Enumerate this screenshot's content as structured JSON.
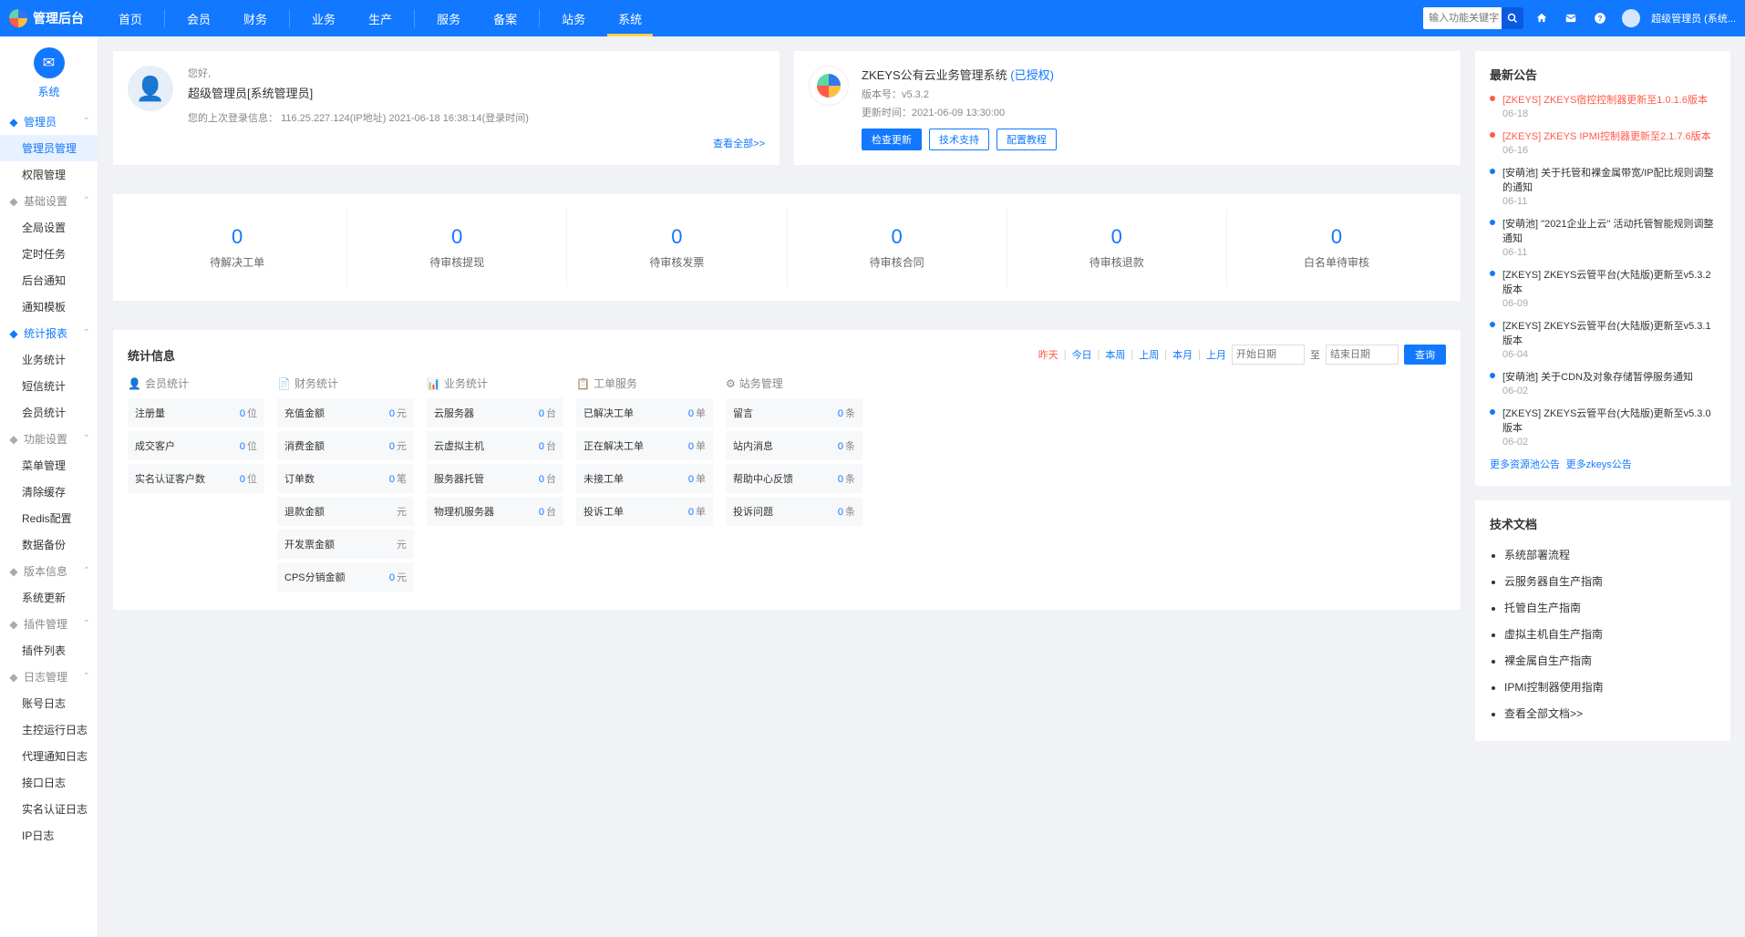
{
  "brand": "管理后台",
  "nav": [
    "首页",
    "会员",
    "财务",
    "业务",
    "生产",
    "服务",
    "备案",
    "站务",
    "系统"
  ],
  "nav_active": 8,
  "search": {
    "placeholder": "输入功能关键字进行搜索"
  },
  "user_display": "超级管理员 (系统...",
  "sidebar": {
    "current": {
      "label": "系统"
    },
    "groups": [
      {
        "title": "管理员",
        "theme": "blue",
        "items": [
          "管理员管理",
          "权限管理"
        ],
        "active_index": 0
      },
      {
        "title": "基础设置",
        "theme": "grey",
        "items": [
          "全局设置",
          "定时任务",
          "后台通知",
          "通知模板"
        ]
      },
      {
        "title": "统计报表",
        "theme": "blue",
        "items": [
          "业务统计",
          "短信统计",
          "会员统计"
        ]
      },
      {
        "title": "功能设置",
        "theme": "grey",
        "items": [
          "菜单管理",
          "清除缓存",
          "Redis配置",
          "数据备份"
        ]
      },
      {
        "title": "版本信息",
        "theme": "grey",
        "items": [
          "系统更新"
        ]
      },
      {
        "title": "插件管理",
        "theme": "grey",
        "items": [
          "插件列表"
        ]
      },
      {
        "title": "日志管理",
        "theme": "grey",
        "items": [
          "账号日志",
          "主控运行日志",
          "代理通知日志",
          "接口日志",
          "实名认证日志",
          "IP日志"
        ]
      }
    ]
  },
  "welcome": {
    "hello": "您好,",
    "name": "超级管理员[系统管理员]",
    "login_label": "您的上次登录信息：",
    "login_info": "116.25.227.124(IP地址) 2021-06-18 16:38:14(登录时间)",
    "viewall": "查看全部>>"
  },
  "sysinfo": {
    "title": "ZKEYS公有云业务管理系统",
    "auth": "(已授权)",
    "version_label": "版本号：",
    "version": "v5.3.2",
    "update_label": "更新时间：",
    "update_time": "2021-06-09 13:30:00",
    "btn_check": "检查更新",
    "btn_tech": "技术支持",
    "btn_cfg": "配置教程"
  },
  "counters": [
    {
      "num": "0",
      "label": "待解决工单"
    },
    {
      "num": "0",
      "label": "待审核提现"
    },
    {
      "num": "0",
      "label": "待审核发票"
    },
    {
      "num": "0",
      "label": "待审核合同"
    },
    {
      "num": "0",
      "label": "待审核退款"
    },
    {
      "num": "0",
      "label": "白名单待审核"
    }
  ],
  "stats": {
    "title": "统计信息",
    "range": [
      "昨天",
      "今日",
      "本周",
      "上周",
      "本月",
      "上月"
    ],
    "range_cur": 0,
    "start_ph": "开始日期",
    "to": "至",
    "end_ph": "结束日期",
    "query": "查询",
    "cols": [
      {
        "header": "会员统计",
        "icon": "👤",
        "rows": [
          {
            "label": "注册量",
            "val": "0",
            "unit": "位"
          },
          {
            "label": "成交客户",
            "val": "0",
            "unit": "位"
          },
          {
            "label": "实名认证客户数",
            "val": "0",
            "unit": "位"
          }
        ]
      },
      {
        "header": "财务统计",
        "icon": "📄",
        "rows": [
          {
            "label": "充值金额",
            "val": "0",
            "unit": "元"
          },
          {
            "label": "消费金额",
            "val": "0",
            "unit": "元"
          },
          {
            "label": "订单数",
            "val": "0",
            "unit": "笔"
          },
          {
            "label": "退款金额",
            "val": "",
            "unit": "元"
          },
          {
            "label": "开发票金额",
            "val": "",
            "unit": "元"
          },
          {
            "label": "CPS分销金额",
            "val": "0",
            "unit": "元"
          }
        ]
      },
      {
        "header": "业务统计",
        "icon": "📊",
        "rows": [
          {
            "label": "云服务器",
            "val": "0",
            "unit": "台"
          },
          {
            "label": "云虚拟主机",
            "val": "0",
            "unit": "台"
          },
          {
            "label": "服务器托管",
            "val": "0",
            "unit": "台"
          },
          {
            "label": "物理机服务器",
            "val": "0",
            "unit": "台"
          }
        ]
      },
      {
        "header": "工单服务",
        "icon": "📋",
        "rows": [
          {
            "label": "已解决工单",
            "val": "0",
            "unit": "单"
          },
          {
            "label": "正在解决工单",
            "val": "0",
            "unit": "单"
          },
          {
            "label": "未接工单",
            "val": "0",
            "unit": "单"
          },
          {
            "label": "投诉工单",
            "val": "0",
            "unit": "单"
          }
        ]
      },
      {
        "header": "站务管理",
        "icon": "⚙",
        "rows": [
          {
            "label": "留言",
            "val": "0",
            "unit": "条"
          },
          {
            "label": "站内消息",
            "val": "0",
            "unit": "条"
          },
          {
            "label": "帮助中心反馈",
            "val": "0",
            "unit": "条"
          },
          {
            "label": "投诉问题",
            "val": "0",
            "unit": "条"
          }
        ]
      }
    ]
  },
  "announcements": {
    "title": "最新公告",
    "items": [
      {
        "title": "[ZKEYS] ZKEYS宿控控制器更新至1.0.1.6版本",
        "date": "06-18",
        "red": true
      },
      {
        "title": "[ZKEYS] ZKEYS IPMI控制器更新至2.1.7.6版本",
        "date": "06-16",
        "red": true
      },
      {
        "title": "[安萌池] 关于托管和裸金属带宽/IP配比规则调整的通知",
        "date": "06-11",
        "red": false
      },
      {
        "title": "[安萌池]  \"2021企业上云\" 活动托管智能规则调整通知",
        "date": "06-11",
        "red": false
      },
      {
        "title": "[ZKEYS] ZKEYS云管平台(大陆版)更新至v5.3.2版本",
        "date": "06-09",
        "red": false
      },
      {
        "title": "[ZKEYS] ZKEYS云管平台(大陆版)更新至v5.3.1版本",
        "date": "06-04",
        "red": false
      },
      {
        "title": "[安萌池] 关于CDN及对象存储暂停服务通知",
        "date": "06-02",
        "red": false
      },
      {
        "title": "[ZKEYS] ZKEYS云管平台(大陆版)更新至v5.3.0版本",
        "date": "06-02",
        "red": false
      }
    ],
    "more1": "更多资源池公告",
    "more2": "更多zkeys公告"
  },
  "docs": {
    "title": "技术文档",
    "items": [
      "系统部署流程",
      "云服务器自生产指南",
      "托管自生产指南",
      "虚拟主机自生产指南",
      "裸金属自生产指南",
      "IPMI控制器使用指南",
      "查看全部文档>>"
    ]
  }
}
